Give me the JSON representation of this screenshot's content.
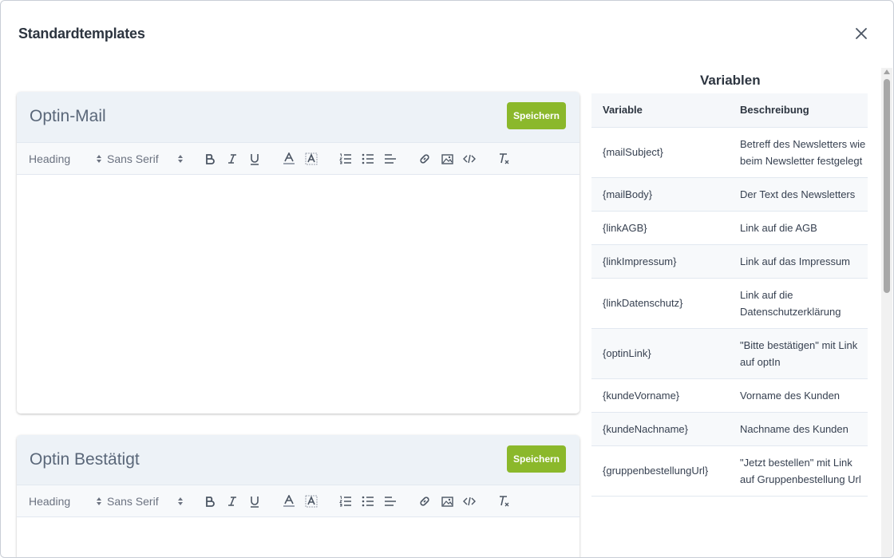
{
  "modal": {
    "title": "Standardtemplates"
  },
  "toolbar": {
    "heading": "Heading",
    "font": "Sans Serif"
  },
  "editors": [
    {
      "title": "Optin-Mail",
      "save_label": "Speichern"
    },
    {
      "title": "Optin Bestätigt",
      "save_label": "Speichern"
    }
  ],
  "variables": {
    "heading": "Variablen",
    "columns": [
      "Variable",
      "Beschreibung"
    ],
    "rows": [
      {
        "name": "{mailSubject}",
        "desc": "Betreff des Newsletters wie beim Newsletter festgelegt"
      },
      {
        "name": "{mailBody}",
        "desc": "Der Text des Newsletters"
      },
      {
        "name": "{linkAGB}",
        "desc": "Link auf die AGB"
      },
      {
        "name": "{linkImpressum}",
        "desc": "Link auf das Impressum"
      },
      {
        "name": "{linkDatenschutz}",
        "desc": "Link auf die Datenschutzerklärung"
      },
      {
        "name": "{optinLink}",
        "desc": "\"Bitte bestätigen\" mit Link auf optIn"
      },
      {
        "name": "{kundeVorname}",
        "desc": "Vorname des Kunden"
      },
      {
        "name": "{kundeNachname}",
        "desc": "Nachname des Kunden"
      },
      {
        "name": "{gruppenbestellungUrl}",
        "desc": "\"Jetzt bestellen\" mit Link auf Gruppenbestellung Url"
      }
    ]
  },
  "colors": {
    "save_button": "#8bb82b",
    "card_header": "#edf2f7"
  }
}
